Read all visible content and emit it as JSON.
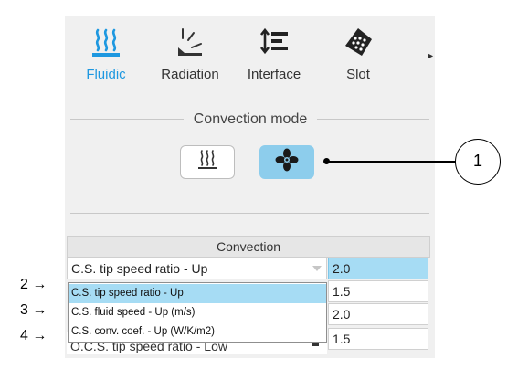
{
  "tabs": [
    {
      "label": "Fluidic",
      "icon": "heat-waves-icon",
      "active": true
    },
    {
      "label": "Radiation",
      "icon": "radiation-icon",
      "active": false
    },
    {
      "label": "Interface",
      "icon": "interface-icon",
      "active": false
    },
    {
      "label": "Slot",
      "icon": "slot-icon",
      "active": false
    }
  ],
  "section": {
    "title": "Convection mode"
  },
  "mode_buttons": [
    {
      "icon": "natural-convection-icon",
      "selected": false
    },
    {
      "icon": "forced-convection-fan-icon",
      "selected": true
    }
  ],
  "table": {
    "header": "Convection",
    "selected_parameter": "C.S. tip speed ratio - Up",
    "values": [
      "2.0",
      "1.5",
      "2.0",
      "1.5"
    ],
    "row_under_dropdown": "O.C.S. tip speed ratio - Low"
  },
  "dropdown": {
    "options": [
      "C.S. tip speed ratio - Up",
      "C.S. fluid speed - Up (m/s)",
      "C.S. conv. coef. - Up (W/K/m2)"
    ],
    "highlighted_index": 0
  },
  "annotations": {
    "callout": "1",
    "steps": [
      "2 →",
      "3 →",
      "4 →"
    ]
  },
  "colors": {
    "accent": "#1e98e0",
    "selected_fill": "#a6dcf4",
    "toggle_on": "#8dcdec",
    "panel_bg": "#f0f0f0"
  }
}
